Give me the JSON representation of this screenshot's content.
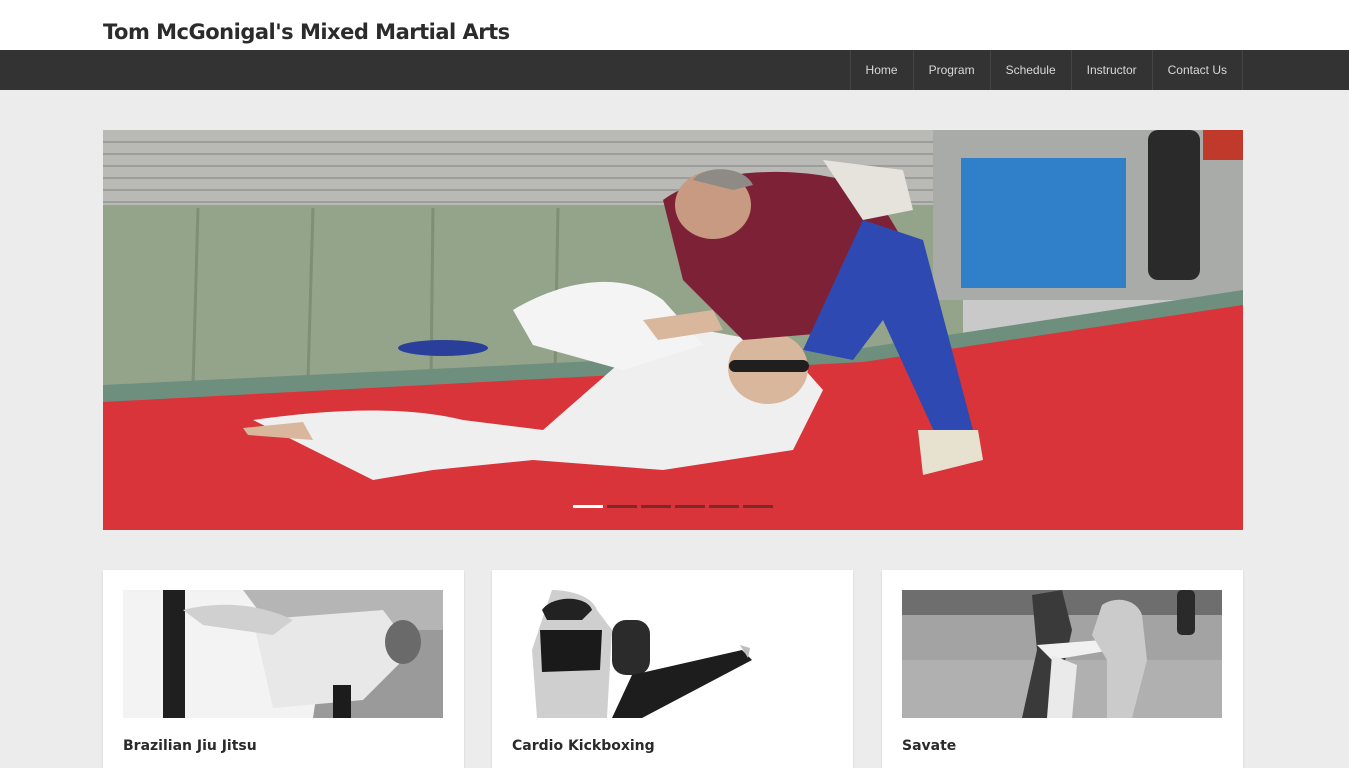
{
  "site": {
    "title": "Tom McGonigal's Mixed Martial Arts"
  },
  "nav": {
    "items": [
      {
        "label": "Home"
      },
      {
        "label": "Program"
      },
      {
        "label": "Schedule"
      },
      {
        "label": "Instructor"
      },
      {
        "label": "Contact Us"
      }
    ]
  },
  "slider": {
    "image": "photo of two grapplers training on a red mat",
    "slide_count": 6,
    "active_slide": 1
  },
  "programs": [
    {
      "title": "Brazilian Jiu Jitsu",
      "image": "black-and-white photo of jiu jitsu ground grappling"
    },
    {
      "title": "Cardio Kickboxing",
      "image": "black-and-white photo of a woman kicking with boxing gloves"
    },
    {
      "title": "Savate",
      "image": "black-and-white photo of savate kicking practice"
    }
  ],
  "colors": {
    "navbar": "#333333",
    "background": "#ececec",
    "mat": "#d8343a",
    "slider_dot": "#7a2a2a"
  }
}
